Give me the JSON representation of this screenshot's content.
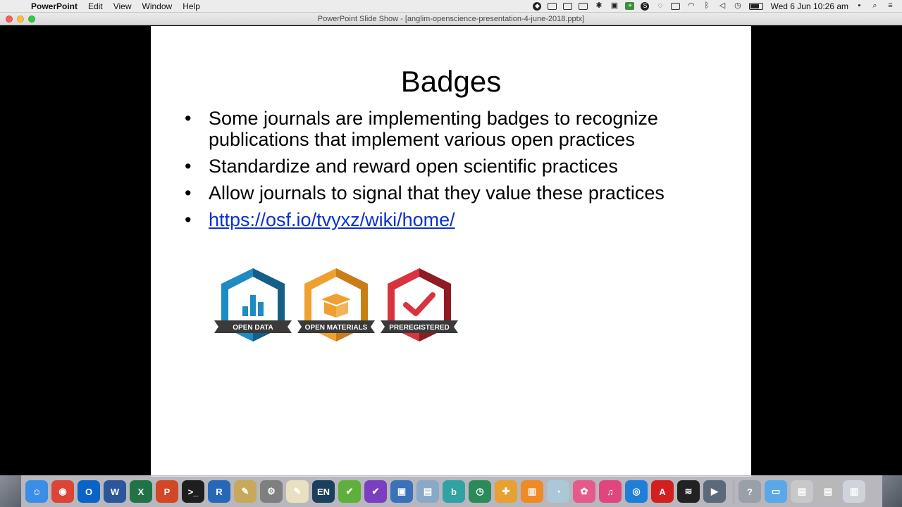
{
  "menubar": {
    "apple_glyph": "",
    "items": [
      {
        "label": "PowerPoint"
      },
      {
        "label": "Edit"
      },
      {
        "label": "View"
      },
      {
        "label": "Window"
      },
      {
        "label": "Help"
      }
    ],
    "clock": "Wed 6 Jun  10:26 am",
    "battery_level": 0.8
  },
  "window": {
    "title": "PowerPoint Slide Show - [anglim-openscience-presentation-4-june-2018.pptx]"
  },
  "slide": {
    "title": "Badges",
    "bullets": [
      {
        "text": "Some journals are implementing badges to recognize publications that implement various open practices"
      },
      {
        "text": "Standardize and reward open scientific practices"
      },
      {
        "text": "Allow journals to signal that they value these practices"
      },
      {
        "link": "https://osf.io/tvyxz/wiki/home/"
      }
    ],
    "bullet_glyph": "•",
    "badges": [
      {
        "label": "OPEN DATA",
        "color_light": "#1e8bc3",
        "color_dark": "#145f87",
        "icon": "bar-chart-icon"
      },
      {
        "label": "OPEN MATERIALS",
        "color_light": "#f0a030",
        "color_dark": "#c97d17",
        "icon": "box-icon"
      },
      {
        "label": "PREREGISTERED",
        "color_light": "#d8333f",
        "color_dark": "#8f1c24",
        "icon": "checkmark-icon"
      }
    ]
  },
  "dock": {
    "apps": [
      {
        "name": "finder",
        "glyph": "☺",
        "color": "#3a8ee6"
      },
      {
        "name": "chrome",
        "glyph": "◉",
        "color": "#db4437"
      },
      {
        "name": "outlook",
        "glyph": "O",
        "color": "#0a64c8"
      },
      {
        "name": "word",
        "glyph": "W",
        "color": "#2b579a"
      },
      {
        "name": "excel",
        "glyph": "X",
        "color": "#217346"
      },
      {
        "name": "powerpoint",
        "glyph": "P",
        "color": "#d24726"
      },
      {
        "name": "terminal",
        "glyph": ">_",
        "color": "#1e1e1e"
      },
      {
        "name": "r",
        "glyph": "R",
        "color": "#2767b8"
      },
      {
        "name": "scrivener",
        "glyph": "✎",
        "color": "#c8a95a"
      },
      {
        "name": "system-preferences",
        "glyph": "⚙",
        "color": "#7f7f7f"
      },
      {
        "name": "notes",
        "glyph": "✎",
        "color": "#e8e0c0"
      },
      {
        "name": "keyboard-en",
        "glyph": "EN",
        "color": "#1b3f5e"
      },
      {
        "name": "editor",
        "glyph": "✔",
        "color": "#5db13b"
      },
      {
        "name": "omnifocus",
        "glyph": "✔",
        "color": "#7a3fc0"
      },
      {
        "name": "remote-desktop",
        "glyph": "▣",
        "color": "#3872b8"
      },
      {
        "name": "preview",
        "glyph": "▤",
        "color": "#8aa9c8"
      },
      {
        "name": "bbedit",
        "glyph": "b",
        "color": "#2fa3a3"
      },
      {
        "name": "time-machine",
        "glyph": "◷",
        "color": "#2c8a5a"
      },
      {
        "name": "app-store",
        "glyph": "✚",
        "color": "#e8a030"
      },
      {
        "name": "ibooks",
        "glyph": "▥",
        "color": "#f08a24"
      },
      {
        "name": "preview-2",
        "glyph": "◔",
        "color": "#aac8d8"
      },
      {
        "name": "photos",
        "glyph": "✿",
        "color": "#e65a8a"
      },
      {
        "name": "itunes",
        "glyph": "♫",
        "color": "#e0467e"
      },
      {
        "name": "safari",
        "glyph": "◎",
        "color": "#1e7ed8"
      },
      {
        "name": "acrobat",
        "glyph": "A",
        "color": "#d41f1f"
      },
      {
        "name": "activity-monitor",
        "glyph": "≋",
        "color": "#222"
      },
      {
        "name": "screen-recorder",
        "glyph": "▶",
        "color": "#5a6a7a"
      }
    ],
    "right_items": [
      {
        "name": "help",
        "glyph": "?",
        "color": "#9aa0a8"
      },
      {
        "name": "folder",
        "glyph": "▭",
        "color": "#5aa8e8"
      },
      {
        "name": "documents",
        "glyph": "▤",
        "color": "#c8c8c8"
      },
      {
        "name": "downloads",
        "glyph": "▤",
        "color": "#b8b8b8"
      },
      {
        "name": "trash",
        "glyph": "▥",
        "color": "#d0d4da"
      }
    ]
  }
}
